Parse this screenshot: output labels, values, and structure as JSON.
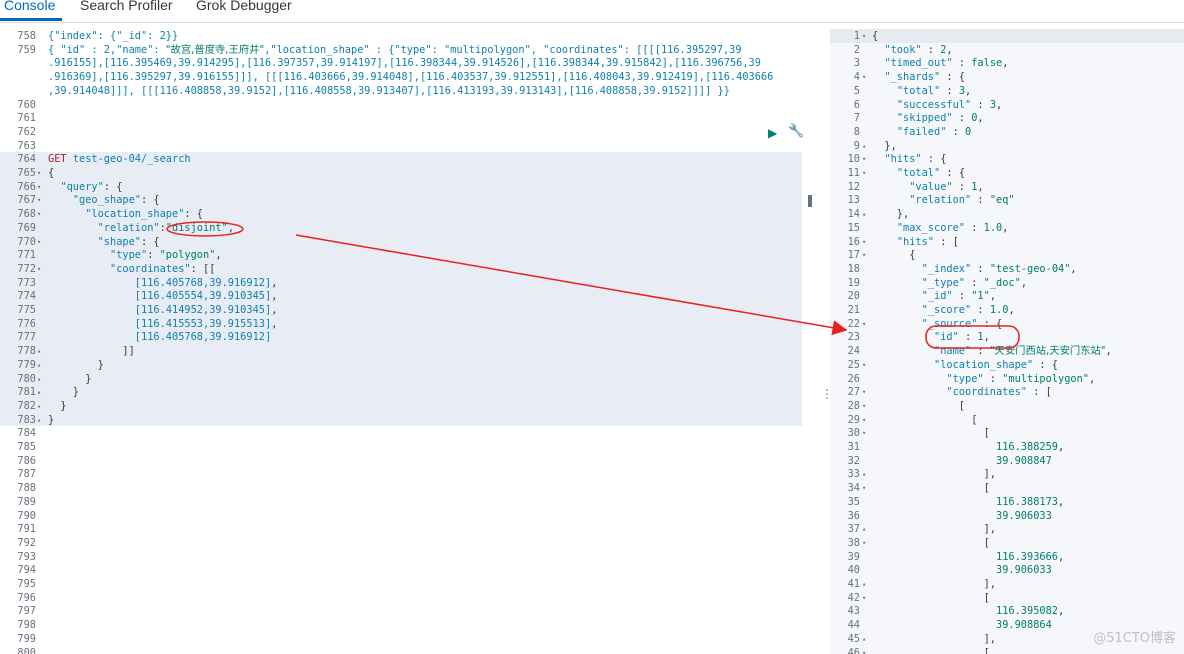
{
  "tabs": [
    "Console",
    "Search Profiler",
    "Grok Debugger"
  ],
  "editor": {
    "lines": [
      {
        "n": "758",
        "f": "",
        "h": "<span class=\"k\">{\"index\": {\"_id\": 2}}</span>"
      },
      {
        "n": "759",
        "f": "",
        "h": "<span class=\"k\">{ \"id\" : 2,\"name\": </span><span class=\"cjk\">\"故宫,普度寺,王府井\"</span><span class=\"k\">,\"location_shape\" : {\"type\": \"multipolygon\", \"coordinates\": [[[[116.395297,39</span>"
      },
      {
        "n": "",
        "f": "",
        "h": "<span class=\"k\">.916155],[116.395469,39.914295],[116.397357,39.914197],[116.398344,39.914526],[116.398344,39.915842],[116.396756,39</span>"
      },
      {
        "n": "",
        "f": "",
        "h": "<span class=\"k\">.916369],[116.395297,39.916155]]], [[[116.403666,39.914048],[116.403537,39.912551],[116.408043,39.912419],[116.403666</span>"
      },
      {
        "n": "",
        "f": "",
        "h": "<span class=\"k\">,39.914048]]], [[[116.408858,39.9152],[116.408558,39.913407],[116.413193,39.913143],[116.408858,39.9152]]]] }}</span>"
      },
      {
        "n": "760",
        "f": "",
        "h": ""
      },
      {
        "n": "761",
        "f": "",
        "h": ""
      },
      {
        "n": "762",
        "f": "",
        "h": ""
      },
      {
        "n": "763",
        "f": "",
        "h": ""
      },
      {
        "n": "764",
        "f": "",
        "h": "<span class=\"cn\">GET</span> <span class=\"k\">test-geo-04/_search</span>"
      },
      {
        "n": "765",
        "f": "▾",
        "h": "<span class=\"punc\">{</span>"
      },
      {
        "n": "766",
        "f": "▾",
        "h": "  <span class=\"k\">\"query\"</span>: {"
      },
      {
        "n": "767",
        "f": "▾",
        "h": "    <span class=\"k\">\"geo_shape\"</span>: {"
      },
      {
        "n": "768",
        "f": "▾",
        "h": "      <span class=\"k\">\"location_shape\"</span>: {"
      },
      {
        "n": "769",
        "f": "",
        "h": "        <span class=\"k\">\"relation\"</span>:<span class=\"v\">\"disjoint\"</span>,"
      },
      {
        "n": "770",
        "f": "▾",
        "h": "        <span class=\"k\">\"shape\"</span>: {"
      },
      {
        "n": "771",
        "f": "",
        "h": "          <span class=\"k\">\"type\"</span>: <span class=\"v\">\"polygon\"</span>,"
      },
      {
        "n": "772",
        "f": "▾",
        "h": "          <span class=\"k\">\"coordinates\"</span>: [["
      },
      {
        "n": "773",
        "f": "",
        "h": "              <span class=\"k\">[116.405768,39.916912]</span>,"
      },
      {
        "n": "774",
        "f": "",
        "h": "              <span class=\"k\">[116.405554,39.910345]</span>,"
      },
      {
        "n": "775",
        "f": "",
        "h": "              <span class=\"k\">[116.414952,39.910345]</span>,"
      },
      {
        "n": "776",
        "f": "",
        "h": "              <span class=\"k\">[116.415553,39.915513]</span>,"
      },
      {
        "n": "777",
        "f": "",
        "h": "              <span class=\"k\">[116.405768,39.916912]</span>"
      },
      {
        "n": "778",
        "f": "▴",
        "h": "            ]]"
      },
      {
        "n": "779",
        "f": "▴",
        "h": "        }"
      },
      {
        "n": "780",
        "f": "▴",
        "h": "      }"
      },
      {
        "n": "781",
        "f": "▴",
        "h": "    }"
      },
      {
        "n": "782",
        "f": "▴",
        "h": "  }"
      },
      {
        "n": "783",
        "f": "▴",
        "h": "}"
      },
      {
        "n": "784",
        "f": "",
        "h": ""
      },
      {
        "n": "785",
        "f": "",
        "h": ""
      },
      {
        "n": "786",
        "f": "",
        "h": ""
      },
      {
        "n": "787",
        "f": "",
        "h": ""
      },
      {
        "n": "788",
        "f": "",
        "h": ""
      },
      {
        "n": "789",
        "f": "",
        "h": ""
      },
      {
        "n": "790",
        "f": "",
        "h": ""
      },
      {
        "n": "791",
        "f": "",
        "h": ""
      },
      {
        "n": "792",
        "f": "",
        "h": ""
      },
      {
        "n": "793",
        "f": "",
        "h": ""
      },
      {
        "n": "794",
        "f": "",
        "h": ""
      },
      {
        "n": "795",
        "f": "",
        "h": ""
      },
      {
        "n": "796",
        "f": "",
        "h": ""
      },
      {
        "n": "797",
        "f": "",
        "h": ""
      },
      {
        "n": "798",
        "f": "",
        "h": ""
      },
      {
        "n": "799",
        "f": "",
        "h": ""
      },
      {
        "n": "800",
        "f": "",
        "h": ""
      }
    ]
  },
  "output": {
    "lines": [
      {
        "n": "1",
        "f": "▾",
        "h": "{"
      },
      {
        "n": "2",
        "f": "",
        "h": "  <span class=\"k\">\"took\"</span> : <span class=\"v\">2</span>,"
      },
      {
        "n": "3",
        "f": "",
        "h": "  <span class=\"k\">\"timed_out\"</span> : <span class=\"v\">false</span>,"
      },
      {
        "n": "4",
        "f": "▾",
        "h": "  <span class=\"k\">\"_shards\"</span> : {"
      },
      {
        "n": "5",
        "f": "",
        "h": "    <span class=\"k\">\"total\"</span> : <span class=\"v\">3</span>,"
      },
      {
        "n": "6",
        "f": "",
        "h": "    <span class=\"k\">\"successful\"</span> : <span class=\"v\">3</span>,"
      },
      {
        "n": "7",
        "f": "",
        "h": "    <span class=\"k\">\"skipped\"</span> : <span class=\"v\">0</span>,"
      },
      {
        "n": "8",
        "f": "",
        "h": "    <span class=\"k\">\"failed\"</span> : <span class=\"v\">0</span>"
      },
      {
        "n": "9",
        "f": "▴",
        "h": "  },"
      },
      {
        "n": "10",
        "f": "▾",
        "h": "  <span class=\"k\">\"hits\"</span> : {"
      },
      {
        "n": "11",
        "f": "▾",
        "h": "    <span class=\"k\">\"total\"</span> : {"
      },
      {
        "n": "12",
        "f": "",
        "h": "      <span class=\"k\">\"value\"</span> : <span class=\"v\">1</span>,"
      },
      {
        "n": "13",
        "f": "",
        "h": "      <span class=\"k\">\"relation\"</span> : <span class=\"v\">\"eq\"</span>"
      },
      {
        "n": "14",
        "f": "▴",
        "h": "    },"
      },
      {
        "n": "15",
        "f": "",
        "h": "    <span class=\"k\">\"max_score\"</span> : <span class=\"v\">1.0</span>,"
      },
      {
        "n": "16",
        "f": "▾",
        "h": "    <span class=\"k\">\"hits\"</span> : ["
      },
      {
        "n": "17",
        "f": "▾",
        "h": "      {"
      },
      {
        "n": "18",
        "f": "",
        "h": "        <span class=\"k\">\"_index\"</span> : <span class=\"v\">\"test-geo-04\"</span>,"
      },
      {
        "n": "19",
        "f": "",
        "h": "        <span class=\"k\">\"_type\"</span> : <span class=\"v\">\"_doc\"</span>,"
      },
      {
        "n": "20",
        "f": "",
        "h": "        <span class=\"k\">\"_id\"</span> : <span class=\"v\">\"1\"</span>,"
      },
      {
        "n": "21",
        "f": "",
        "h": "        <span class=\"k\">\"_score\"</span> : <span class=\"v\">1.0</span>,"
      },
      {
        "n": "22",
        "f": "▾",
        "h": "        <span class=\"k\">\"_source\"</span> : {"
      },
      {
        "n": "23",
        "f": "",
        "h": "          <span class=\"k\">\"id\"</span> : <span class=\"v\">1</span>,"
      },
      {
        "n": "24",
        "f": "",
        "h": "          <span class=\"k\">\"name\"</span> : <span class=\"cjk\">\"天安门西站,天安门东站\"</span>,"
      },
      {
        "n": "25",
        "f": "▾",
        "h": "          <span class=\"k\">\"location_shape\"</span> : {"
      },
      {
        "n": "26",
        "f": "",
        "h": "            <span class=\"k\">\"type\"</span> : <span class=\"v\">\"multipolygon\"</span>,"
      },
      {
        "n": "27",
        "f": "▾",
        "h": "            <span class=\"k\">\"coordinates\"</span> : ["
      },
      {
        "n": "28",
        "f": "▾",
        "h": "              ["
      },
      {
        "n": "29",
        "f": "▾",
        "h": "                ["
      },
      {
        "n": "30",
        "f": "▾",
        "h": "                  ["
      },
      {
        "n": "31",
        "f": "",
        "h": "                    <span class=\"v\">116.388259</span>,"
      },
      {
        "n": "32",
        "f": "",
        "h": "                    <span class=\"v\">39.908847</span>"
      },
      {
        "n": "33",
        "f": "▴",
        "h": "                  ],"
      },
      {
        "n": "34",
        "f": "▾",
        "h": "                  ["
      },
      {
        "n": "35",
        "f": "",
        "h": "                    <span class=\"v\">116.388173</span>,"
      },
      {
        "n": "36",
        "f": "",
        "h": "                    <span class=\"v\">39.906033</span>"
      },
      {
        "n": "37",
        "f": "▴",
        "h": "                  ],"
      },
      {
        "n": "38",
        "f": "▾",
        "h": "                  ["
      },
      {
        "n": "39",
        "f": "",
        "h": "                    <span class=\"v\">116.393666</span>,"
      },
      {
        "n": "40",
        "f": "",
        "h": "                    <span class=\"v\">39.906033</span>"
      },
      {
        "n": "41",
        "f": "▴",
        "h": "                  ],"
      },
      {
        "n": "42",
        "f": "▾",
        "h": "                  ["
      },
      {
        "n": "43",
        "f": "",
        "h": "                    <span class=\"v\">116.395082</span>,"
      },
      {
        "n": "44",
        "f": "",
        "h": "                    <span class=\"v\">39.908864</span>"
      },
      {
        "n": "45",
        "f": "▴",
        "h": "                  ],"
      },
      {
        "n": "46",
        "f": "▾",
        "h": "                  ["
      }
    ]
  },
  "watermark": "@51CTO博客"
}
